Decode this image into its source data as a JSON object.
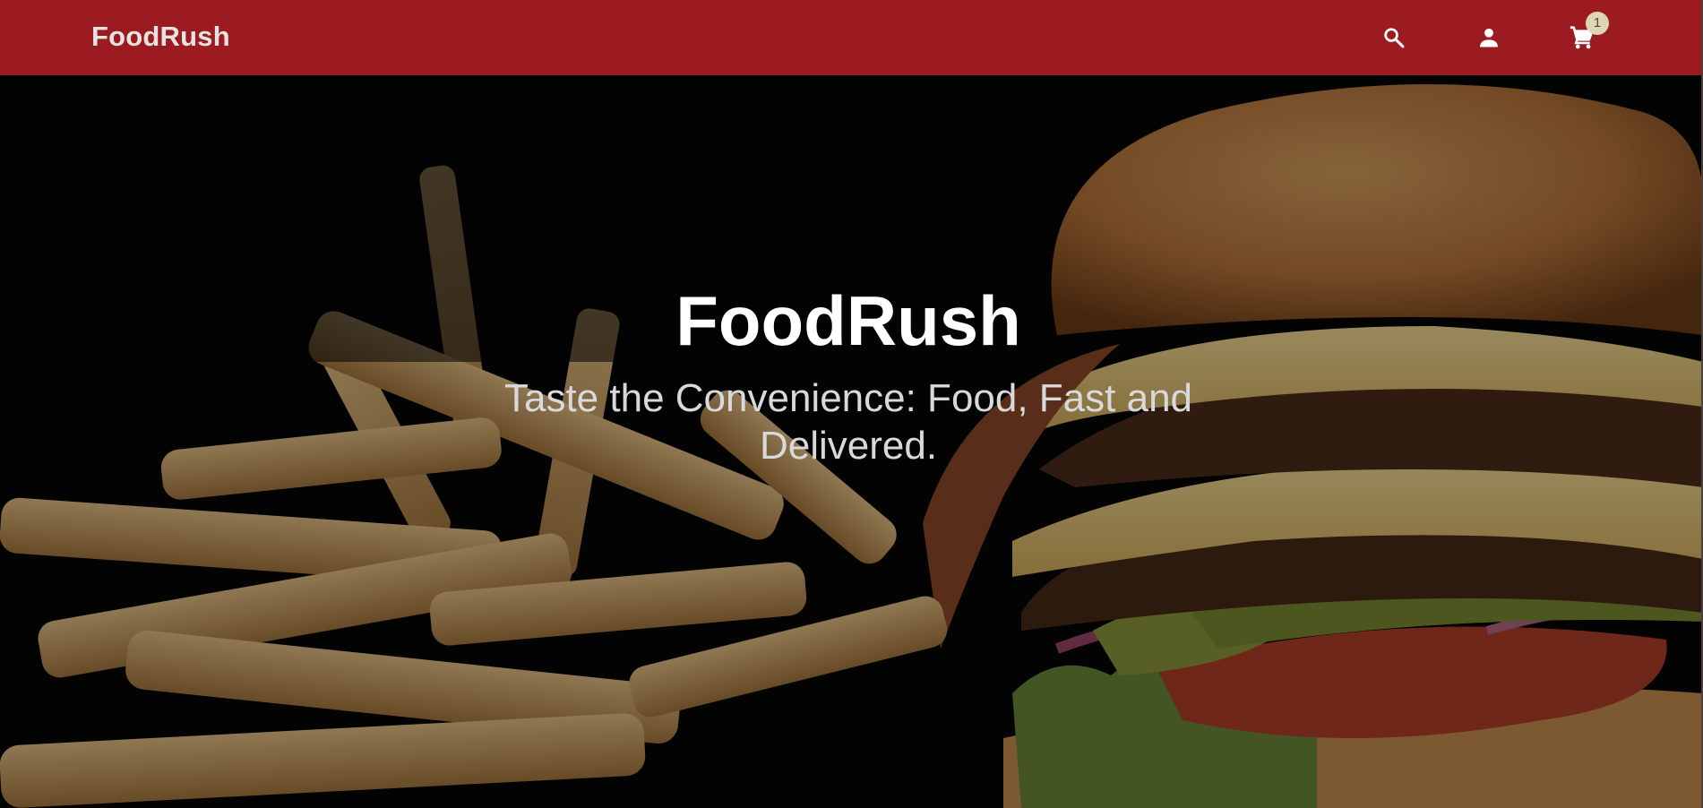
{
  "header": {
    "brand": "FoodRush",
    "icons": {
      "search": "search-icon",
      "account": "account-icon",
      "cart": "cart-icon"
    },
    "cart_count": "1"
  },
  "hero": {
    "title": "FoodRush",
    "subtitle": "Taste the Convenience: Food, Fast and Delivered.",
    "background_image": "burger-and-fries-photo"
  },
  "colors": {
    "navbar": "#9b1b20",
    "brand_text": "#e8e3e3",
    "badge": "#dcd6b4",
    "hero_title": "#ffffff",
    "hero_subtitle": "#d9d9dc"
  }
}
